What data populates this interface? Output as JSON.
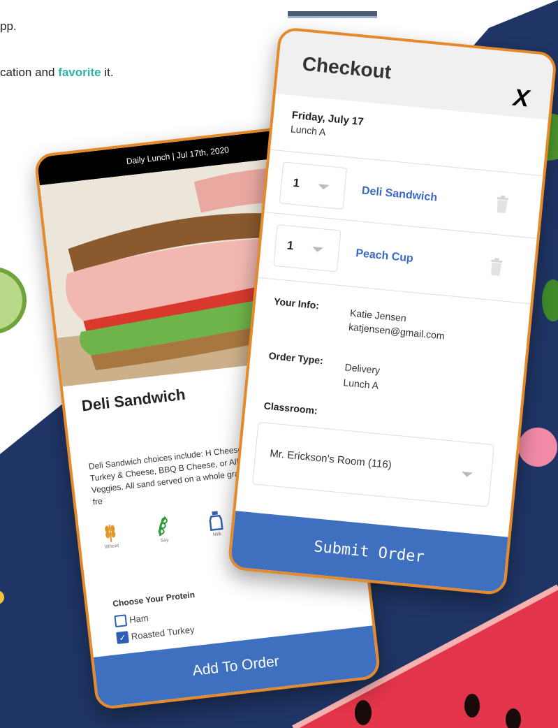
{
  "intro": {
    "line1": "pp.",
    "line2_before": "cation and ",
    "line2_accent": "favorite",
    "line2_after": " it."
  },
  "colors": {
    "navy": "#1f3565",
    "orange_border": "#e48a2b",
    "button_blue": "#3f6fbf",
    "link_blue": "#3b68c4",
    "accent_teal": "#2bb3a0"
  },
  "menu_item": {
    "header": "Daily Lunch | Jul 17th, 2020",
    "title": "Deli Sandwich",
    "description": "Deli Sandwich choices include: H Cheese, Turkey & Cheese, BBQ B Cheese, or All Veggies. All sand served on a whole grain deli-fre",
    "allergens": [
      {
        "label": "Wheat",
        "icon": "wheat-icon"
      },
      {
        "label": "Soy",
        "icon": "soy-icon"
      },
      {
        "label": "Milk",
        "icon": "milk-icon"
      }
    ],
    "protein_heading": "Choose Your Protein",
    "protein_options": [
      {
        "label": "Ham",
        "checked": false
      },
      {
        "label": "Roasted Turkey",
        "checked": true
      }
    ],
    "add_button": "Add To Order"
  },
  "checkout": {
    "title": "Checkout",
    "close": "X",
    "date": "Friday, July 17",
    "lunch": "Lunch A",
    "items": [
      {
        "qty": "1",
        "name": "Deli Sandwich"
      },
      {
        "qty": "1",
        "name": "Peach Cup"
      }
    ],
    "your_info_label": "Your Info:",
    "name": "Katie Jensen",
    "email": "katjensen@gmail.com",
    "order_type_label": "Order Type:",
    "order_type": "Delivery",
    "order_type_lunch": "Lunch A",
    "classroom_label": "Classroom:",
    "classroom": "Mr. Erickson's Room (116)",
    "submit": "Submit Order"
  }
}
